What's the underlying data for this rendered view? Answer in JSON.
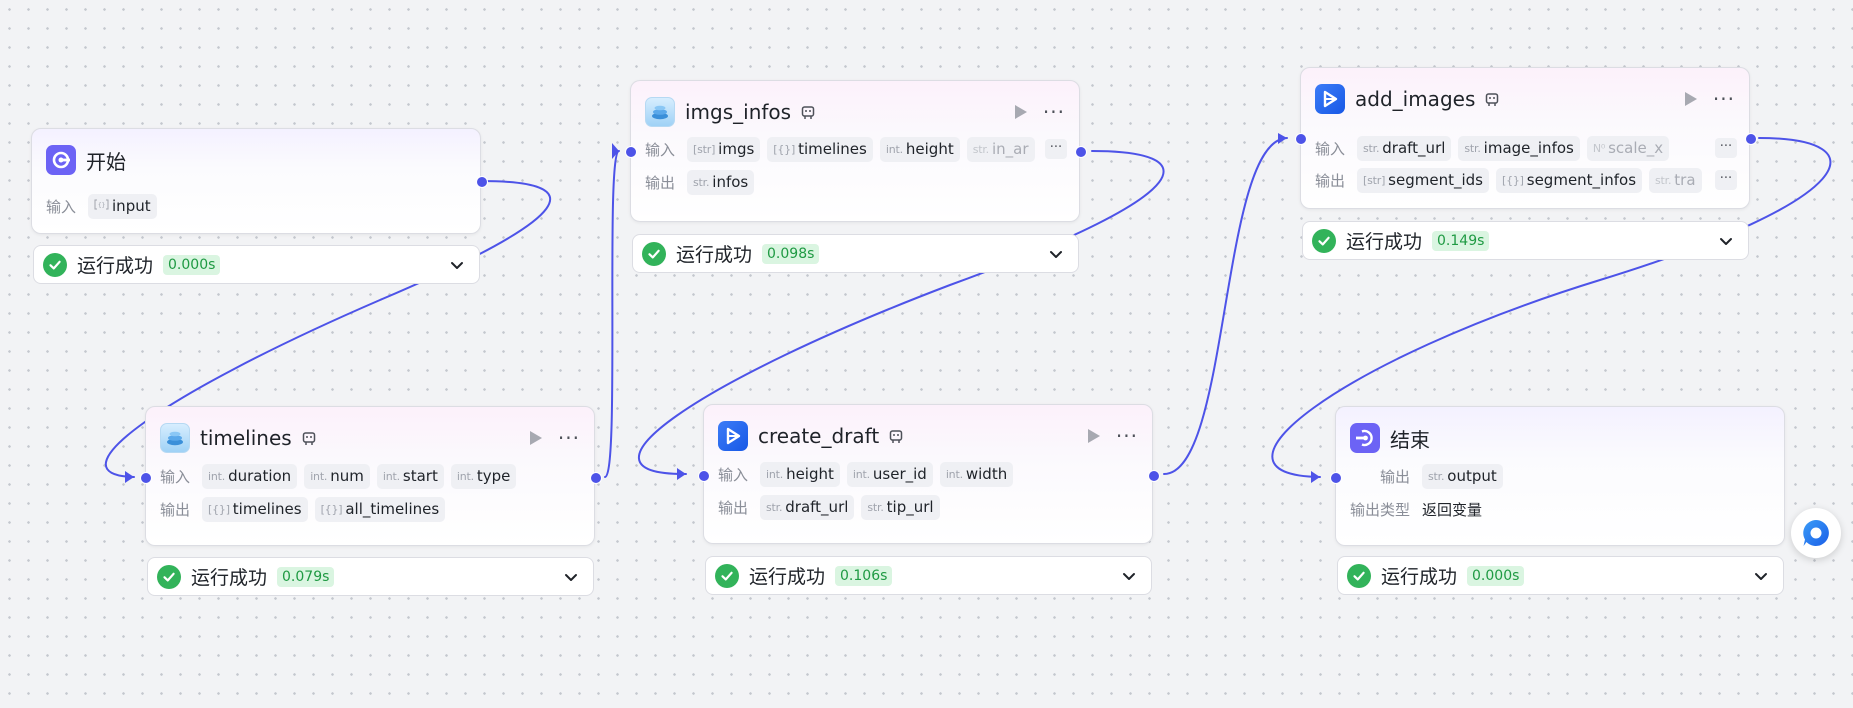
{
  "labels": {
    "input": "输入",
    "output": "输出",
    "output_type": "输出类型"
  },
  "status_text": "运行成功",
  "colors": {
    "edge": "#4d53e8",
    "success": "#32b35a",
    "accent": "#6c63f5"
  },
  "nodes": {
    "start": {
      "title": "开始",
      "icon": "start-icon",
      "inputs": [
        {
          "type": "icon-obj",
          "name": "input"
        }
      ],
      "time": "0.000s"
    },
    "timelines": {
      "title": "timelines",
      "icon": "plugin-icon",
      "inputs": [
        {
          "type": "int.",
          "name": "duration"
        },
        {
          "type": "int.",
          "name": "num"
        },
        {
          "type": "int.",
          "name": "start"
        },
        {
          "type": "int.",
          "name": "type"
        }
      ],
      "outputs": [
        {
          "type": "[{}]",
          "name": "timelines"
        },
        {
          "type": "[{}]",
          "name": "all_timelines"
        }
      ],
      "time": "0.079s"
    },
    "imgs_infos": {
      "title": "imgs_infos",
      "icon": "plugin-icon",
      "inputs": [
        {
          "type": "[str]",
          "name": "imgs"
        },
        {
          "type": "[{}]",
          "name": "timelines"
        },
        {
          "type": "int.",
          "name": "height"
        },
        {
          "type": "str.",
          "name": "in_ar"
        }
      ],
      "outputs": [
        {
          "type": "str.",
          "name": "infos"
        }
      ],
      "time": "0.098s"
    },
    "create_draft": {
      "title": "create_draft",
      "icon": "capcut-icon",
      "inputs": [
        {
          "type": "int.",
          "name": "height"
        },
        {
          "type": "int.",
          "name": "user_id"
        },
        {
          "type": "int.",
          "name": "width"
        }
      ],
      "outputs": [
        {
          "type": "str.",
          "name": "draft_url"
        },
        {
          "type": "str.",
          "name": "tip_url"
        }
      ],
      "time": "0.106s"
    },
    "add_images": {
      "title": "add_images",
      "icon": "capcut-icon",
      "inputs": [
        {
          "type": "str.",
          "name": "draft_url"
        },
        {
          "type": "str.",
          "name": "image_infos"
        },
        {
          "type": "N⁰",
          "name": "scale_x"
        }
      ],
      "outputs": [
        {
          "type": "[str]",
          "name": "segment_ids"
        },
        {
          "type": "[{}]",
          "name": "segment_infos"
        },
        {
          "type": "str.",
          "name": "tra"
        }
      ],
      "time": "0.149s"
    },
    "end": {
      "title": "结束",
      "icon": "end-icon",
      "outputs": [
        {
          "type": "str.",
          "name": "output"
        }
      ],
      "output_type_value": "返回变量",
      "time": "0.000s"
    }
  }
}
